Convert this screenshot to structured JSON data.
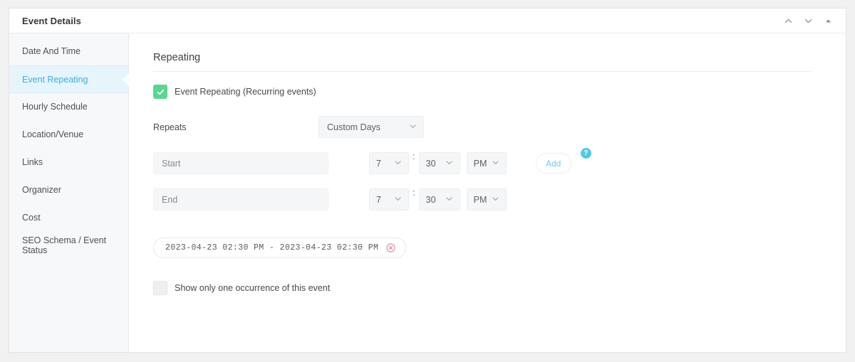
{
  "panel": {
    "title": "Event Details",
    "header_actions": [
      {
        "name": "move-up-icon",
        "label": "Move up"
      },
      {
        "name": "move-down-icon",
        "label": "Move down"
      },
      {
        "name": "toggle-panel-icon",
        "label": "Toggle panel"
      }
    ]
  },
  "sidebar": {
    "items": [
      {
        "label": "Date And Time",
        "active": false
      },
      {
        "label": "Event Repeating",
        "active": true
      },
      {
        "label": "Hourly Schedule",
        "active": false
      },
      {
        "label": "Location/Venue",
        "active": false
      },
      {
        "label": "Links",
        "active": false
      },
      {
        "label": "Organizer",
        "active": false
      },
      {
        "label": "Cost",
        "active": false
      },
      {
        "label": "SEO Schema / Event Status",
        "active": false
      }
    ]
  },
  "main": {
    "section_title": "Repeating",
    "enable_repeating": {
      "label": "Event Repeating (Recurring events)",
      "checked": true
    },
    "repeats": {
      "label": "Repeats",
      "value": "Custom Days",
      "options": [
        "Custom Days"
      ]
    },
    "start": {
      "placeholder": "Start",
      "value": "",
      "hour": "7",
      "minute": "30",
      "meridiem": "PM",
      "separator": ":"
    },
    "end": {
      "placeholder": "End",
      "value": "",
      "hour": "7",
      "minute": "30",
      "meridiem": "PM",
      "separator": ":"
    },
    "add_button": "Add",
    "help_icon": "?",
    "chips": [
      {
        "text": "2023-04-23 02:30 PM - 2023-04-23 02:30 PM"
      }
    ],
    "show_one_occurrence": {
      "label": "Show only one occurrence of this event",
      "checked": false
    }
  },
  "colors": {
    "accent": "#3eaedc",
    "accent_soft": "#e6f4fb",
    "checkbox_on": "#5bd68d",
    "help_bg": "#4ecbe4",
    "add_text": "#67cfe8",
    "chip_remove": "#d9899a"
  }
}
